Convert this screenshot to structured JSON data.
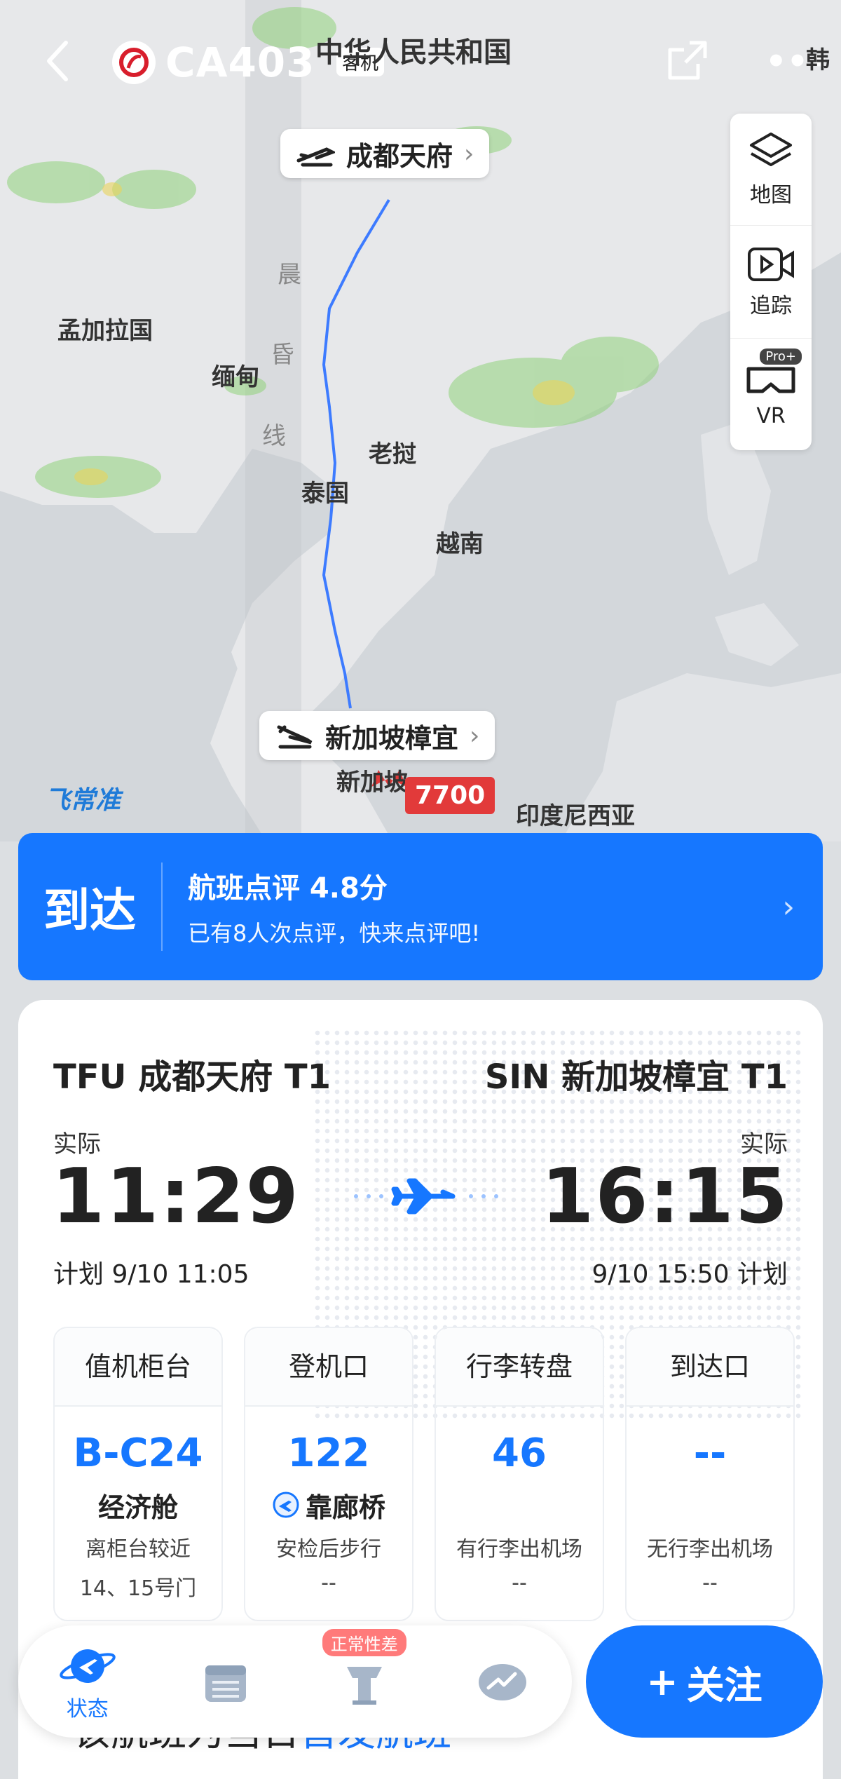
{
  "header": {
    "flight_number": "CA403",
    "aircraft_tag": "客机"
  },
  "map": {
    "countries": {
      "china": "中华人民共和国",
      "bangladesh": "孟加拉国",
      "myanmar": "缅甸",
      "laos": "老挝",
      "thailand": "泰国",
      "vietnam": "越南",
      "indonesia": "印度尼西亚",
      "korea": "韩",
      "singapore": "新加坡"
    },
    "terminator": [
      "晨",
      "昏",
      "线"
    ],
    "origin_pill": "成都天府",
    "dest_pill": "新加坡樟宜",
    "squawk": "7700",
    "brand": "飞常准"
  },
  "tools": {
    "map": "地图",
    "track": "追踪",
    "vr": "VR",
    "pro": "Pro+"
  },
  "banner": {
    "status": "到达",
    "rating_title": "航班点评 4.8分",
    "rating_sub": "已有8人次点评，快来点评吧!"
  },
  "route": {
    "origin": "TFU 成都天府 T1",
    "dest": "SIN 新加坡樟宜 T1",
    "actual_label": "实际",
    "dep_time": "11:29",
    "arr_time": "16:15",
    "dep_plan": "计划 9/10 11:05",
    "arr_plan": "9/10 15:50 计划"
  },
  "info": [
    {
      "head": "值机柜台",
      "value": "B-C24",
      "sub": "经济舱",
      "note": "离柜台较近",
      "note2": "14、15号门"
    },
    {
      "head": "登机口",
      "value": "122",
      "sub": "靠廊桥",
      "note": "安检后步行",
      "note2": "--"
    },
    {
      "head": "行李转盘",
      "value": "46",
      "sub": "",
      "note": "有行李出机场",
      "note2": "--"
    },
    {
      "head": "到达口",
      "value": "--",
      "sub": "",
      "note": "无行李出机场",
      "note2": "--"
    }
  ],
  "bottom": {
    "prefix": "该航班为当日",
    "highlight": "首发航班"
  },
  "tabbar": {
    "status_label": "状态",
    "badge": "正常性差"
  },
  "follow": {
    "label": "关注"
  },
  "colors": {
    "accent": "#1677ff",
    "squawk": "#e23a3a"
  }
}
